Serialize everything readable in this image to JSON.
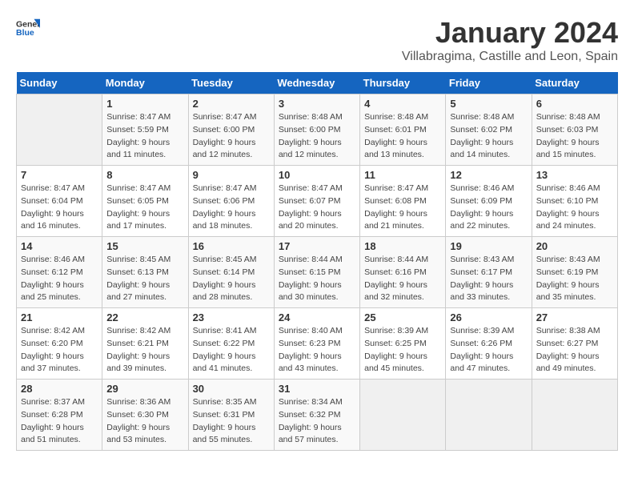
{
  "header": {
    "logo_general": "General",
    "logo_blue": "Blue",
    "month": "January 2024",
    "location": "Villabragima, Castille and Leon, Spain"
  },
  "days_of_week": [
    "Sunday",
    "Monday",
    "Tuesday",
    "Wednesday",
    "Thursday",
    "Friday",
    "Saturday"
  ],
  "weeks": [
    [
      {
        "day": "",
        "sunrise": "",
        "sunset": "",
        "daylight": ""
      },
      {
        "day": "1",
        "sunrise": "Sunrise: 8:47 AM",
        "sunset": "Sunset: 5:59 PM",
        "daylight": "Daylight: 9 hours and 11 minutes."
      },
      {
        "day": "2",
        "sunrise": "Sunrise: 8:47 AM",
        "sunset": "Sunset: 6:00 PM",
        "daylight": "Daylight: 9 hours and 12 minutes."
      },
      {
        "day": "3",
        "sunrise": "Sunrise: 8:48 AM",
        "sunset": "Sunset: 6:00 PM",
        "daylight": "Daylight: 9 hours and 12 minutes."
      },
      {
        "day": "4",
        "sunrise": "Sunrise: 8:48 AM",
        "sunset": "Sunset: 6:01 PM",
        "daylight": "Daylight: 9 hours and 13 minutes."
      },
      {
        "day": "5",
        "sunrise": "Sunrise: 8:48 AM",
        "sunset": "Sunset: 6:02 PM",
        "daylight": "Daylight: 9 hours and 14 minutes."
      },
      {
        "day": "6",
        "sunrise": "Sunrise: 8:48 AM",
        "sunset": "Sunset: 6:03 PM",
        "daylight": "Daylight: 9 hours and 15 minutes."
      }
    ],
    [
      {
        "day": "7",
        "sunrise": "Sunrise: 8:47 AM",
        "sunset": "Sunset: 6:04 PM",
        "daylight": "Daylight: 9 hours and 16 minutes."
      },
      {
        "day": "8",
        "sunrise": "Sunrise: 8:47 AM",
        "sunset": "Sunset: 6:05 PM",
        "daylight": "Daylight: 9 hours and 17 minutes."
      },
      {
        "day": "9",
        "sunrise": "Sunrise: 8:47 AM",
        "sunset": "Sunset: 6:06 PM",
        "daylight": "Daylight: 9 hours and 18 minutes."
      },
      {
        "day": "10",
        "sunrise": "Sunrise: 8:47 AM",
        "sunset": "Sunset: 6:07 PM",
        "daylight": "Daylight: 9 hours and 20 minutes."
      },
      {
        "day": "11",
        "sunrise": "Sunrise: 8:47 AM",
        "sunset": "Sunset: 6:08 PM",
        "daylight": "Daylight: 9 hours and 21 minutes."
      },
      {
        "day": "12",
        "sunrise": "Sunrise: 8:46 AM",
        "sunset": "Sunset: 6:09 PM",
        "daylight": "Daylight: 9 hours and 22 minutes."
      },
      {
        "day": "13",
        "sunrise": "Sunrise: 8:46 AM",
        "sunset": "Sunset: 6:10 PM",
        "daylight": "Daylight: 9 hours and 24 minutes."
      }
    ],
    [
      {
        "day": "14",
        "sunrise": "Sunrise: 8:46 AM",
        "sunset": "Sunset: 6:12 PM",
        "daylight": "Daylight: 9 hours and 25 minutes."
      },
      {
        "day": "15",
        "sunrise": "Sunrise: 8:45 AM",
        "sunset": "Sunset: 6:13 PM",
        "daylight": "Daylight: 9 hours and 27 minutes."
      },
      {
        "day": "16",
        "sunrise": "Sunrise: 8:45 AM",
        "sunset": "Sunset: 6:14 PM",
        "daylight": "Daylight: 9 hours and 28 minutes."
      },
      {
        "day": "17",
        "sunrise": "Sunrise: 8:44 AM",
        "sunset": "Sunset: 6:15 PM",
        "daylight": "Daylight: 9 hours and 30 minutes."
      },
      {
        "day": "18",
        "sunrise": "Sunrise: 8:44 AM",
        "sunset": "Sunset: 6:16 PM",
        "daylight": "Daylight: 9 hours and 32 minutes."
      },
      {
        "day": "19",
        "sunrise": "Sunrise: 8:43 AM",
        "sunset": "Sunset: 6:17 PM",
        "daylight": "Daylight: 9 hours and 33 minutes."
      },
      {
        "day": "20",
        "sunrise": "Sunrise: 8:43 AM",
        "sunset": "Sunset: 6:19 PM",
        "daylight": "Daylight: 9 hours and 35 minutes."
      }
    ],
    [
      {
        "day": "21",
        "sunrise": "Sunrise: 8:42 AM",
        "sunset": "Sunset: 6:20 PM",
        "daylight": "Daylight: 9 hours and 37 minutes."
      },
      {
        "day": "22",
        "sunrise": "Sunrise: 8:42 AM",
        "sunset": "Sunset: 6:21 PM",
        "daylight": "Daylight: 9 hours and 39 minutes."
      },
      {
        "day": "23",
        "sunrise": "Sunrise: 8:41 AM",
        "sunset": "Sunset: 6:22 PM",
        "daylight": "Daylight: 9 hours and 41 minutes."
      },
      {
        "day": "24",
        "sunrise": "Sunrise: 8:40 AM",
        "sunset": "Sunset: 6:23 PM",
        "daylight": "Daylight: 9 hours and 43 minutes."
      },
      {
        "day": "25",
        "sunrise": "Sunrise: 8:39 AM",
        "sunset": "Sunset: 6:25 PM",
        "daylight": "Daylight: 9 hours and 45 minutes."
      },
      {
        "day": "26",
        "sunrise": "Sunrise: 8:39 AM",
        "sunset": "Sunset: 6:26 PM",
        "daylight": "Daylight: 9 hours and 47 minutes."
      },
      {
        "day": "27",
        "sunrise": "Sunrise: 8:38 AM",
        "sunset": "Sunset: 6:27 PM",
        "daylight": "Daylight: 9 hours and 49 minutes."
      }
    ],
    [
      {
        "day": "28",
        "sunrise": "Sunrise: 8:37 AM",
        "sunset": "Sunset: 6:28 PM",
        "daylight": "Daylight: 9 hours and 51 minutes."
      },
      {
        "day": "29",
        "sunrise": "Sunrise: 8:36 AM",
        "sunset": "Sunset: 6:30 PM",
        "daylight": "Daylight: 9 hours and 53 minutes."
      },
      {
        "day": "30",
        "sunrise": "Sunrise: 8:35 AM",
        "sunset": "Sunset: 6:31 PM",
        "daylight": "Daylight: 9 hours and 55 minutes."
      },
      {
        "day": "31",
        "sunrise": "Sunrise: 8:34 AM",
        "sunset": "Sunset: 6:32 PM",
        "daylight": "Daylight: 9 hours and 57 minutes."
      },
      {
        "day": "",
        "sunrise": "",
        "sunset": "",
        "daylight": ""
      },
      {
        "day": "",
        "sunrise": "",
        "sunset": "",
        "daylight": ""
      },
      {
        "day": "",
        "sunrise": "",
        "sunset": "",
        "daylight": ""
      }
    ]
  ]
}
